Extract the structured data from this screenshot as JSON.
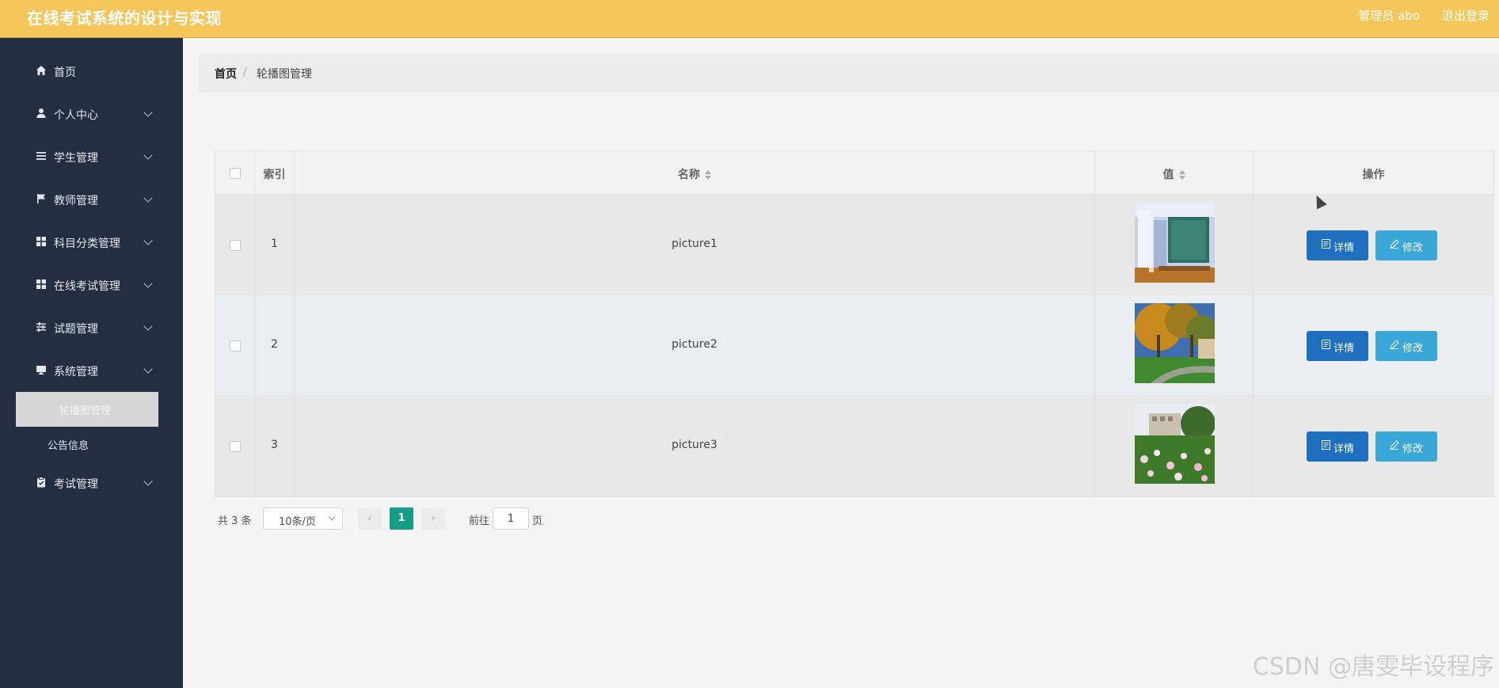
{
  "header": {
    "title": "在线考试系统的设计与实现",
    "user": "管理员 abo",
    "logout": "退出登录"
  },
  "sidebar": {
    "items": [
      {
        "label": "首页",
        "icon": "home-icon"
      },
      {
        "label": "个人中心",
        "icon": "user-icon"
      },
      {
        "label": "学生管理",
        "icon": "list-icon"
      },
      {
        "label": "教师管理",
        "icon": "flag-icon"
      },
      {
        "label": "科目分类管理",
        "icon": "grid-icon"
      },
      {
        "label": "在线考试管理",
        "icon": "grid-icon"
      },
      {
        "label": "试题管理",
        "icon": "sliders-icon"
      },
      {
        "label": "系统管理",
        "icon": "monitor-icon"
      },
      {
        "label": "考试管理",
        "icon": "clipboard-icon"
      }
    ],
    "sub_items": [
      {
        "label": "轮播图管理",
        "active": true
      },
      {
        "label": "公告信息",
        "active": false
      }
    ]
  },
  "breadcrumb": {
    "home": "首页",
    "separator": "/",
    "current": "轮播图管理"
  },
  "table": {
    "columns": [
      "索引",
      "名称",
      "值",
      "操作"
    ],
    "rows": [
      {
        "index": "1",
        "name": "picture1",
        "image": "classroom-photo"
      },
      {
        "index": "2",
        "name": "picture2",
        "image": "campus-trees-photo"
      },
      {
        "index": "3",
        "name": "picture3",
        "image": "flowers-building-photo"
      }
    ],
    "detail_label": "详情",
    "edit_label": "修改"
  },
  "pagination": {
    "total": "共 3 条",
    "page_size": "10条/页",
    "current_page": "1",
    "goto_label": "前往",
    "goto_value": "1",
    "page_suffix": "页"
  },
  "watermark": "CSDN @唐雯毕设程序"
}
